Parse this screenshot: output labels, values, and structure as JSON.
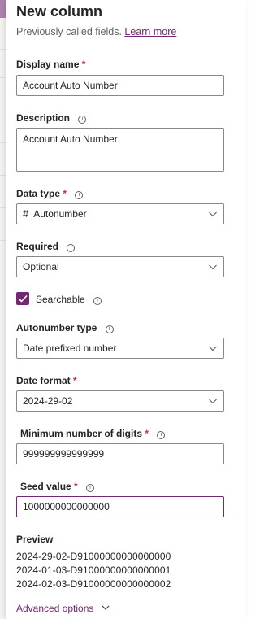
{
  "panel": {
    "title": "New column",
    "subtitle_text": "Previously called fields.",
    "subtitle_link": "Learn more"
  },
  "display_name": {
    "label": "Display name",
    "required_mark": "*",
    "value": "Account Auto Number"
  },
  "description": {
    "label": "Description",
    "value": "Account Auto Number"
  },
  "data_type": {
    "label": "Data type",
    "required_mark": "*",
    "icon": "hash-icon",
    "value": "Autonumber"
  },
  "required": {
    "label": "Required",
    "value": "Optional"
  },
  "searchable": {
    "label": "Searchable",
    "checked": true
  },
  "autonumber_type": {
    "label": "Autonumber type",
    "value": "Date prefixed number"
  },
  "date_format": {
    "label": "Date format",
    "required_mark": "*",
    "value": "2024-29-02"
  },
  "minimum_digits": {
    "label": "Minimum number of digits",
    "required_mark": "*",
    "value": "999999999999999"
  },
  "seed_value": {
    "label": "Seed value",
    "required_mark": "*",
    "value": "1000000000000000"
  },
  "preview": {
    "label": "Preview",
    "lines": [
      "2024-29-02-D91000000000000000",
      "2024-01-03-D91000000000000001",
      "2024-02-03-D91000000000000002"
    ]
  },
  "advanced_options": {
    "label": "Advanced options"
  },
  "colors": {
    "accent": "#742774",
    "required": "#c4314b",
    "border": "#8a8886"
  }
}
